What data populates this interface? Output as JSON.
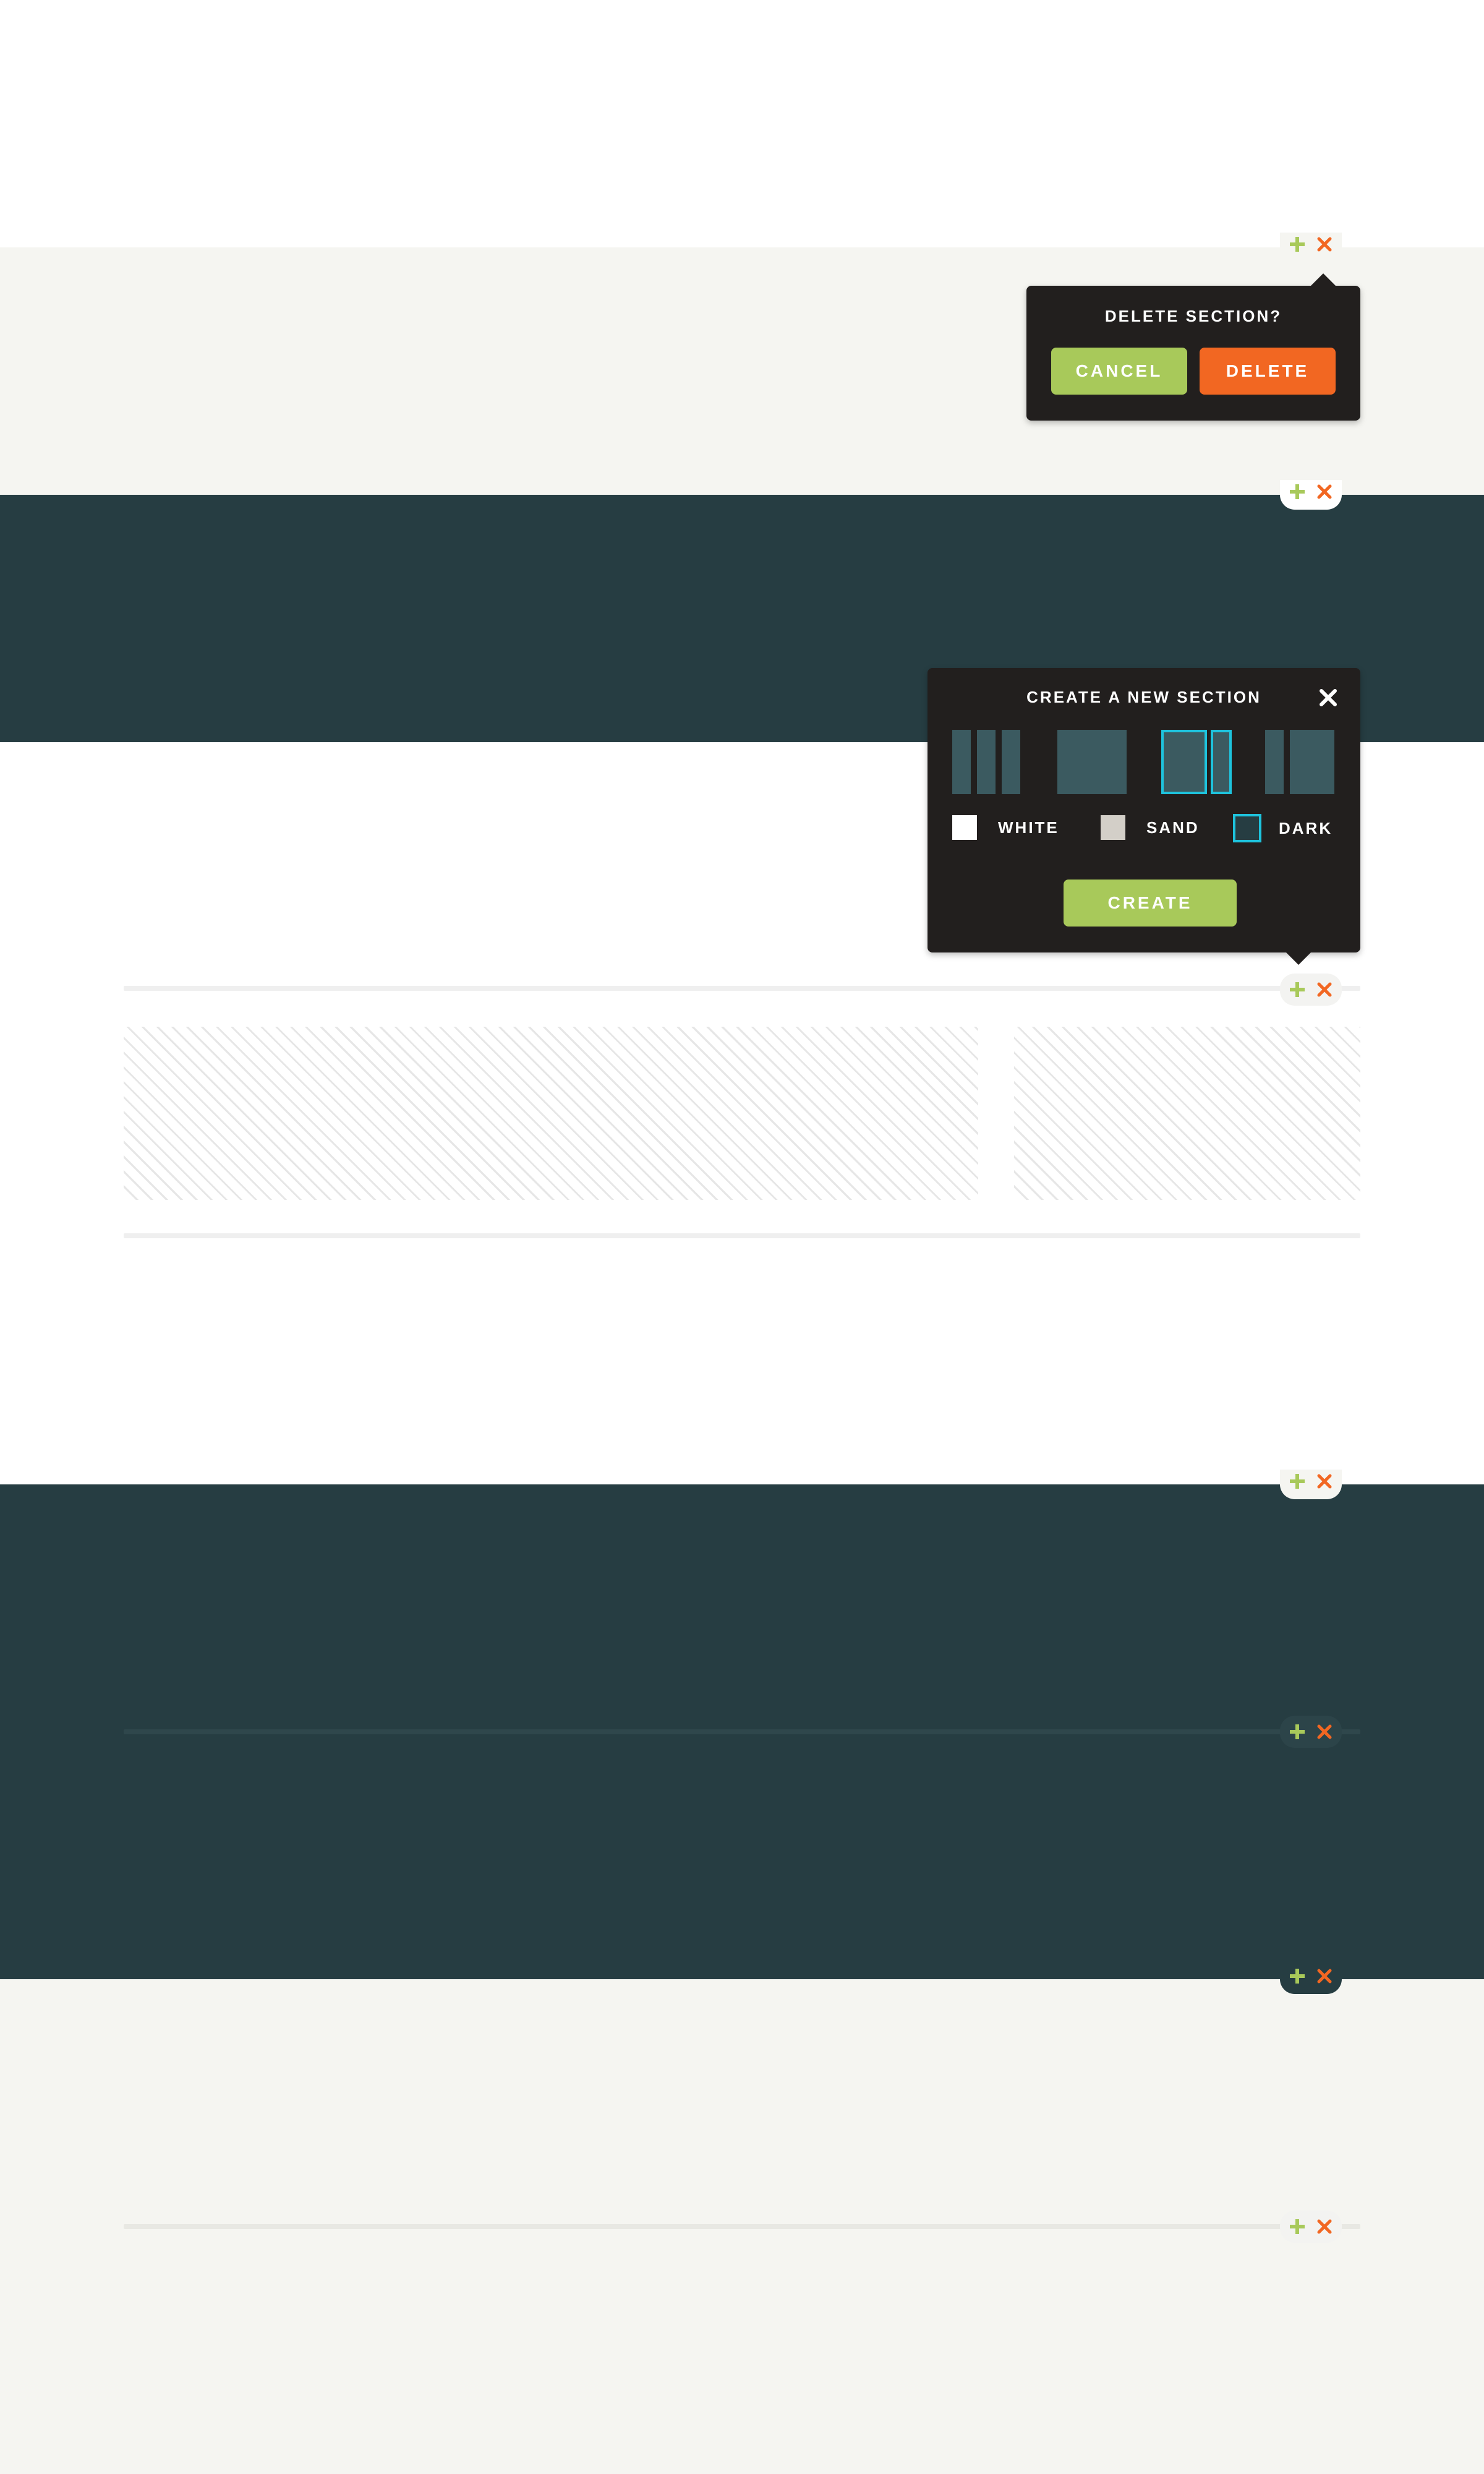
{
  "colors": {
    "white": "#ffffff",
    "sand": "#f5f5f1",
    "dark": "#263d42",
    "popover_bg": "#221f1e",
    "green": "#a8c95a",
    "orange": "#f26722",
    "selected_outline": "#1ec3dd"
  },
  "sections": [
    "white",
    "sand",
    "dark",
    "white",
    "white",
    "dark",
    "dark",
    "sand",
    "sand"
  ],
  "icons": {
    "add": "plus-icon",
    "delete": "x-icon",
    "close": "close-icon"
  },
  "delete_popover": {
    "title": "DELETE SECTION?",
    "cancel_label": "CANCEL",
    "delete_label": "DELETE"
  },
  "create_popover": {
    "title": "CREATE A NEW SECTION",
    "layouts": [
      "three-column",
      "single-column",
      "two-thirds-one-third",
      "one-third-two-thirds"
    ],
    "selected_layout": "two-thirds-one-third",
    "color_options": [
      {
        "label": "WHITE",
        "swatch": "#ffffff"
      },
      {
        "label": "SAND",
        "swatch": "#d3cfc8"
      },
      {
        "label": "DARK",
        "swatch": "#263d42"
      }
    ],
    "selected_color": "DARK",
    "create_label": "CREATE"
  }
}
